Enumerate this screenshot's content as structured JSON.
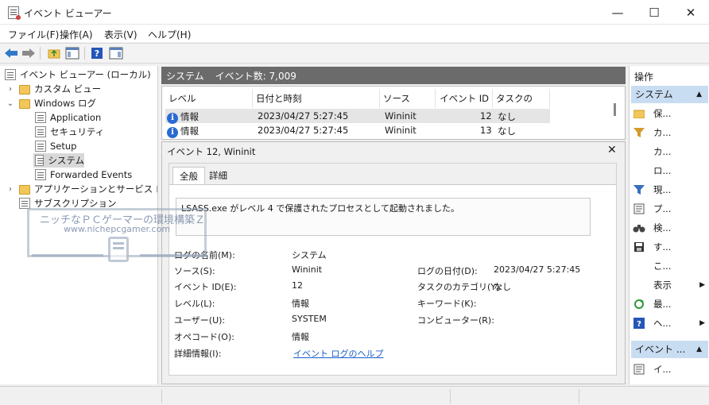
{
  "window": {
    "title": "イベント ビューアー",
    "minimize": "—",
    "maximize": "☐",
    "close": "✕"
  },
  "menu": [
    "ファイル(F)",
    "操作(A)",
    "表示(V)",
    "ヘルプ(H)"
  ],
  "tree": {
    "root": "イベント ビューアー (ローカル)",
    "custom_views": "カスタム ビュー",
    "windows_logs": "Windows ログ",
    "logs": [
      "Application",
      "セキュリティ",
      "Setup",
      "システム",
      "Forwarded Events"
    ],
    "app_services": "アプリケーションとサービス ログ",
    "subscriptions": "サブスクリプション"
  },
  "center": {
    "log_name": "システム",
    "event_count": "イベント数: 7,009"
  },
  "columns": [
    "レベル",
    "日付と時刻",
    "ソース",
    "イベント ID",
    "タスクのカ..."
  ],
  "events": [
    {
      "level": "情報",
      "datetime": "2023/04/27 5:27:45",
      "source": "Wininit",
      "id": "12",
      "task": "なし"
    },
    {
      "level": "情報",
      "datetime": "2023/04/27 5:27:45",
      "source": "Wininit",
      "id": "13",
      "task": "なし"
    }
  ],
  "details": {
    "title": "イベント 12, Wininit",
    "tabs": [
      "全般",
      "詳細"
    ],
    "description": "LSASS.exe がレベル 4 で保護されたプロセスとして起動されました。",
    "labels": {
      "log_name": "ログの名前(M):",
      "source": "ソース(S):",
      "event_id": "イベント ID(E):",
      "level": "レベル(L):",
      "user": "ユーザー(U):",
      "opcode": "オペコード(O):",
      "more_info": "詳細情報(I):",
      "logged": "ログの日付(D):",
      "task_category": "タスクのカテゴリ(Y):",
      "keywords": "キーワード(K):",
      "computer": "コンピューター(R):"
    },
    "values": {
      "log_name": "システム",
      "source": "Wininit",
      "event_id": "12",
      "level": "情報",
      "user": "SYSTEM",
      "opcode": "情報",
      "more_info_link": "イベント ログのヘルプ",
      "logged": "2023/04/27 5:27:45",
      "task_category": "なし"
    }
  },
  "actions": {
    "header": "操作",
    "section1": "システム",
    "items": [
      "保...",
      "カ...",
      "カ...",
      "ロ...",
      "現...",
      "プ...",
      "検...",
      "す...",
      "こ...",
      "表示",
      "最...",
      "ヘ..."
    ],
    "section2": "イベント ...",
    "items2": [
      "イ..."
    ]
  },
  "watermark": {
    "line1": "ニッチなＰＣゲーマーの環境構築Ｚ",
    "line2": "www.nichepcgamer.com"
  }
}
